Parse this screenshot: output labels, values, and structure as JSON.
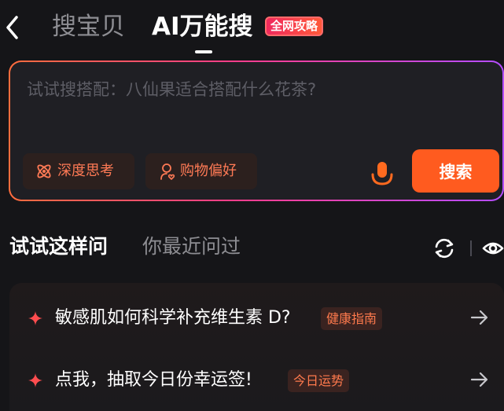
{
  "header": {
    "tabs": [
      {
        "label": "搜宝贝",
        "active": false
      },
      {
        "label": "AI万能搜",
        "active": true
      }
    ],
    "badge": "全网攻略"
  },
  "search": {
    "placeholder": "试试搜搭配：八仙果适合搭配什么花茶?",
    "chips": [
      {
        "label": "深度思考",
        "icon": "atom-icon"
      },
      {
        "label": "购物偏好",
        "icon": "user-heart-icon"
      }
    ],
    "button_label": "搜索"
  },
  "suggestions": {
    "tabs": [
      {
        "label": "试试这样问",
        "active": true
      },
      {
        "label": "你最近问过",
        "active": false
      }
    ],
    "items": [
      {
        "text": "敏感肌如何科学补充维生素 D?",
        "tag": "健康指南"
      },
      {
        "text": "点我，抽取今日份幸运签!",
        "tag": "今日运势"
      }
    ]
  },
  "colors": {
    "accent": "#ff5b1f",
    "tag_text": "#ff7a4d",
    "badge": "#f0295d",
    "sparkle": "#ff4d4f"
  }
}
